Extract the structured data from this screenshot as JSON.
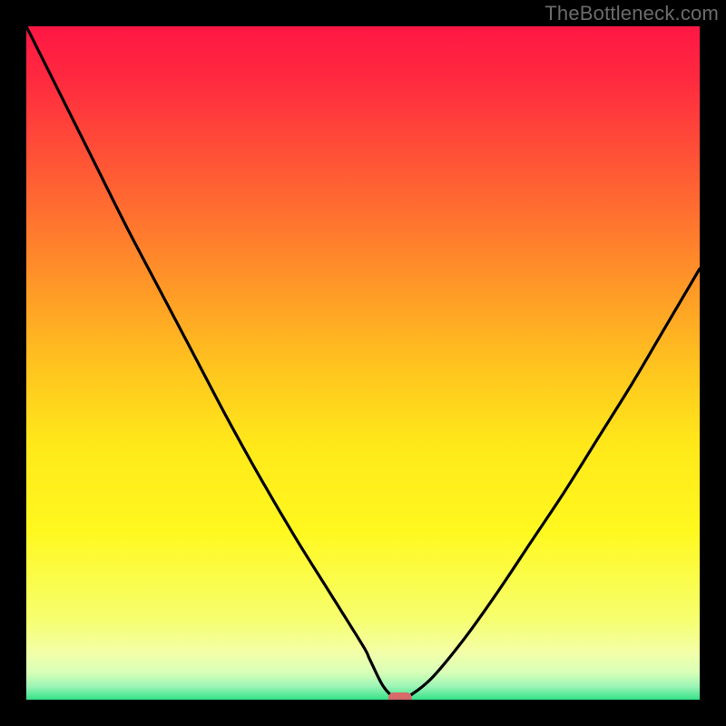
{
  "watermark": "TheBottleneck.com",
  "chart_data": {
    "type": "line",
    "title": "",
    "xlabel": "",
    "ylabel": "",
    "xlim": [
      0,
      100
    ],
    "ylim": [
      0,
      100
    ],
    "grid": false,
    "legend": false,
    "x": [
      0,
      5,
      10,
      15,
      20,
      25,
      30,
      35,
      40,
      45,
      50,
      51,
      53,
      55,
      56,
      60,
      65,
      70,
      75,
      80,
      85,
      90,
      95,
      100
    ],
    "values": [
      100,
      90,
      80,
      70,
      60.5,
      51,
      41.5,
      32.5,
      24,
      16,
      8,
      6,
      2,
      0,
      0,
      3,
      9,
      16,
      23.5,
      31,
      39,
      47,
      55.5,
      64
    ],
    "marker": {
      "x": 55.5,
      "y": 0,
      "color": "#d76a6a"
    },
    "background_gradient": {
      "stops": [
        {
          "offset": 0,
          "color": "#ff1744"
        },
        {
          "offset": 0.08,
          "color": "#ff2a3f"
        },
        {
          "offset": 0.2,
          "color": "#ff5436"
        },
        {
          "offset": 0.35,
          "color": "#ff8a2a"
        },
        {
          "offset": 0.5,
          "color": "#ffc21f"
        },
        {
          "offset": 0.62,
          "color": "#ffe81a"
        },
        {
          "offset": 0.75,
          "color": "#fff81f"
        },
        {
          "offset": 0.88,
          "color": "#f6ff6e"
        },
        {
          "offset": 0.93,
          "color": "#f3ffa8"
        },
        {
          "offset": 0.96,
          "color": "#d8ffb8"
        },
        {
          "offset": 0.98,
          "color": "#9cf5b6"
        },
        {
          "offset": 1.0,
          "color": "#34e28a"
        }
      ]
    }
  }
}
